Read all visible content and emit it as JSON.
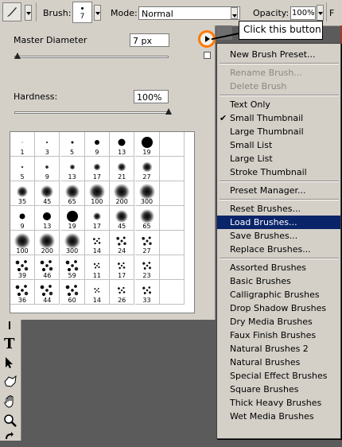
{
  "options_bar": {
    "brush_label": "Brush:",
    "brush_size": "7",
    "mode_label": "Mode:",
    "mode_value": "Normal",
    "opacity_label": "Opacity:",
    "opacity_value": "100%",
    "cut_label": "F"
  },
  "brush_panel": {
    "master_diameter_label": "Master Diameter",
    "master_diameter_value": "7 px",
    "master_diameter_level": 0.02,
    "hardness_label": "Hardness:",
    "hardness_value": "100%",
    "hardness_level": 1.0,
    "presets": [
      {
        "n": "1",
        "t": "hard",
        "s": 1
      },
      {
        "n": "3",
        "t": "hard",
        "s": 2
      },
      {
        "n": "5",
        "t": "hard",
        "s": 3
      },
      {
        "n": "9",
        "t": "hard",
        "s": 6
      },
      {
        "n": "13",
        "t": "hard",
        "s": 9
      },
      {
        "n": "19",
        "t": "hard",
        "s": 14
      },
      {
        "n": "",
        "t": "none",
        "s": 0
      },
      {
        "n": "5",
        "t": "soft",
        "s": 3
      },
      {
        "n": "9",
        "t": "soft",
        "s": 5
      },
      {
        "n": "13",
        "t": "soft",
        "s": 7
      },
      {
        "n": "17",
        "t": "soft",
        "s": 9
      },
      {
        "n": "21",
        "t": "soft",
        "s": 11
      },
      {
        "n": "27",
        "t": "soft",
        "s": 13
      },
      {
        "n": "",
        "t": "none",
        "s": 0
      },
      {
        "n": "35",
        "t": "soft",
        "s": 14
      },
      {
        "n": "45",
        "t": "soft",
        "s": 16
      },
      {
        "n": "65",
        "t": "soft",
        "s": 18
      },
      {
        "n": "100",
        "t": "soft",
        "s": 20
      },
      {
        "n": "200",
        "t": "soft",
        "s": 20
      },
      {
        "n": "300",
        "t": "soft",
        "s": 20
      },
      {
        "n": "",
        "t": "none",
        "s": 0
      },
      {
        "n": "9",
        "t": "hard",
        "s": 7
      },
      {
        "n": "13",
        "t": "hard",
        "s": 10
      },
      {
        "n": "19",
        "t": "hard",
        "s": 14
      },
      {
        "n": "17",
        "t": "soft",
        "s": 10
      },
      {
        "n": "45",
        "t": "soft",
        "s": 16
      },
      {
        "n": "65",
        "t": "soft",
        "s": 18
      },
      {
        "n": "",
        "t": "none",
        "s": 0
      },
      {
        "n": "100",
        "t": "soft",
        "s": 20
      },
      {
        "n": "200",
        "t": "soft",
        "s": 20
      },
      {
        "n": "300",
        "t": "soft",
        "s": 20
      },
      {
        "n": "14",
        "t": "spat",
        "s": 12
      },
      {
        "n": "24",
        "t": "spat",
        "s": 16
      },
      {
        "n": "27",
        "t": "spat",
        "s": 16
      },
      {
        "n": "",
        "t": "none",
        "s": 0
      },
      {
        "n": "39",
        "t": "spat",
        "s": 20
      },
      {
        "n": "46",
        "t": "spat",
        "s": 20
      },
      {
        "n": "59",
        "t": "spat",
        "s": 20
      },
      {
        "n": "11",
        "t": "spat",
        "s": 10
      },
      {
        "n": "17",
        "t": "spat",
        "s": 12
      },
      {
        "n": "23",
        "t": "spat",
        "s": 14
      },
      {
        "n": "",
        "t": "none",
        "s": 0
      },
      {
        "n": "36",
        "t": "spat",
        "s": 20
      },
      {
        "n": "44",
        "t": "spat",
        "s": 20
      },
      {
        "n": "60",
        "t": "spat",
        "s": 20
      },
      {
        "n": "14",
        "t": "spat",
        "s": 9
      },
      {
        "n": "26",
        "t": "spat",
        "s": 12
      },
      {
        "n": "33",
        "t": "spat",
        "s": 14
      },
      {
        "n": "",
        "t": "none",
        "s": 0
      }
    ]
  },
  "callout": {
    "text": "Click this button"
  },
  "menu": {
    "items": [
      {
        "label": "New Brush Preset...",
        "state": "normal"
      },
      {
        "sep": true
      },
      {
        "label": "Rename Brush...",
        "state": "disabled"
      },
      {
        "label": "Delete Brush",
        "state": "disabled"
      },
      {
        "sep": true
      },
      {
        "label": "Text Only",
        "state": "normal"
      },
      {
        "label": "Small Thumbnail",
        "state": "checked"
      },
      {
        "label": "Large Thumbnail",
        "state": "normal"
      },
      {
        "label": "Small List",
        "state": "normal"
      },
      {
        "label": "Large List",
        "state": "normal"
      },
      {
        "label": "Stroke Thumbnail",
        "state": "normal"
      },
      {
        "sep": true
      },
      {
        "label": "Preset Manager...",
        "state": "normal"
      },
      {
        "sep": true
      },
      {
        "label": "Reset Brushes...",
        "state": "normal"
      },
      {
        "label": "Load Brushes...",
        "state": "highlighted"
      },
      {
        "label": "Save Brushes...",
        "state": "normal"
      },
      {
        "label": "Replace Brushes...",
        "state": "normal"
      },
      {
        "sep": true
      },
      {
        "label": "Assorted Brushes",
        "state": "normal"
      },
      {
        "label": "Basic Brushes",
        "state": "normal"
      },
      {
        "label": "Calligraphic Brushes",
        "state": "normal"
      },
      {
        "label": "Drop Shadow Brushes",
        "state": "normal"
      },
      {
        "label": "Dry Media Brushes",
        "state": "normal"
      },
      {
        "label": "Faux Finish Brushes",
        "state": "normal"
      },
      {
        "label": "Natural Brushes 2",
        "state": "normal"
      },
      {
        "label": "Natural Brushes",
        "state": "normal"
      },
      {
        "label": "Special Effect Brushes",
        "state": "normal"
      },
      {
        "label": "Square Brushes",
        "state": "normal"
      },
      {
        "label": "Thick Heavy Brushes",
        "state": "normal"
      },
      {
        "label": "Wet Media Brushes",
        "state": "normal"
      }
    ]
  },
  "toolbox": {
    "type_tool_glyph": "T"
  },
  "colors": {
    "highlight": "#0a246a",
    "callout_ring": "#ff7a00",
    "panel_bg": "#d4d0c8"
  }
}
